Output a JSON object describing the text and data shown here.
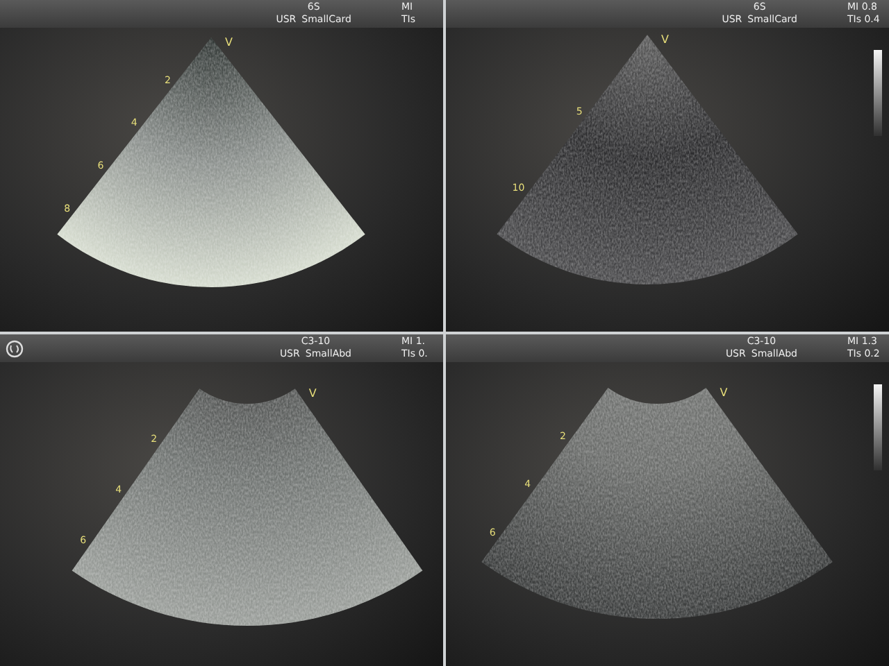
{
  "panels": [
    {
      "logo": false,
      "probe": "6S",
      "preset_prefix": "USR",
      "preset": "SmallCard",
      "mi": "MI",
      "tis": "TIs",
      "grayscale_bar": false,
      "kind": "sector",
      "orientation_mark": "V",
      "depth_marks": [
        "2",
        "4",
        "6",
        "8"
      ]
    },
    {
      "logo": false,
      "probe": "6S",
      "preset_prefix": "USR",
      "preset": "SmallCard",
      "mi": "MI 0.8",
      "tis": "TIs 0.4",
      "grayscale_bar": true,
      "kind": "sector",
      "orientation_mark": "V",
      "depth_marks": [
        "5",
        "10"
      ]
    },
    {
      "logo": true,
      "probe": "C3-10",
      "preset_prefix": "USR",
      "preset": "SmallAbd",
      "mi": "MI 1.",
      "tis": "TIs 0.",
      "grayscale_bar": false,
      "kind": "curved",
      "orientation_mark": "V",
      "depth_marks": [
        "2",
        "4",
        "6"
      ]
    },
    {
      "logo": false,
      "probe": "C3-10",
      "preset_prefix": "USR",
      "preset": "SmallAbd",
      "mi": "MI 1.3",
      "tis": "TIs 0.2",
      "grayscale_bar": true,
      "kind": "curved",
      "orientation_mark": "V",
      "depth_marks": [
        "2",
        "4",
        "6"
      ]
    }
  ]
}
